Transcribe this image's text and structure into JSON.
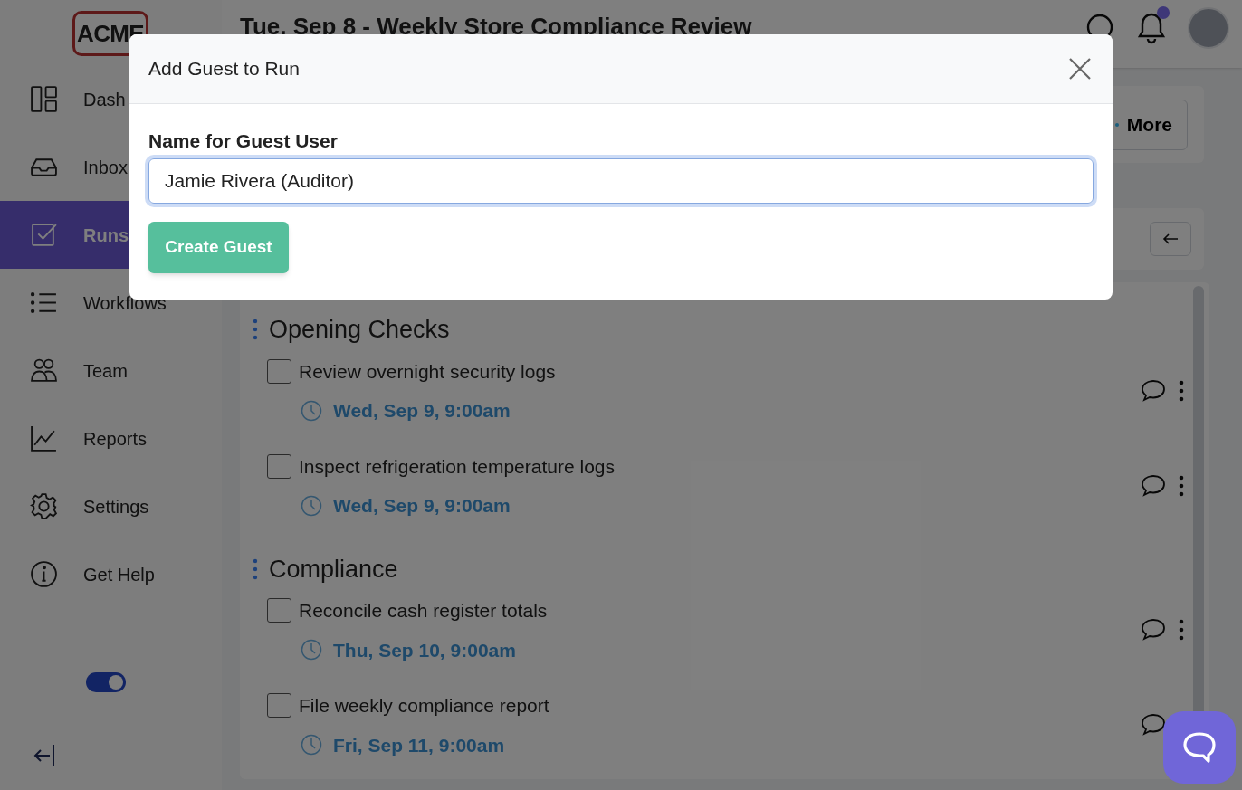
{
  "logo": {
    "text": "ACME"
  },
  "header": {
    "title": "Tue, Sep 8 - Weekly Store Compliance Review",
    "notifications_unread": true
  },
  "sidebar": {
    "items": [
      {
        "label": "Dash",
        "selected": false
      },
      {
        "label": "Inbox",
        "selected": false
      },
      {
        "label": "Runs",
        "selected": true
      },
      {
        "label": "Workflows",
        "selected": false
      },
      {
        "label": "Team",
        "selected": false
      },
      {
        "label": "Reports",
        "selected": false
      },
      {
        "label": "Settings",
        "selected": false
      },
      {
        "label": "Get Help",
        "selected": false
      }
    ],
    "toggle": {
      "on": true
    }
  },
  "toolbar": {
    "more_button": "More"
  },
  "sections": [
    {
      "title": "Opening Checks",
      "tasks": [
        {
          "label": "Review overnight security logs",
          "due": "Wed, Sep 9, 9:00am",
          "checked": false
        },
        {
          "label": "Inspect refrigeration temperature logs",
          "due": "Wed, Sep 9, 9:00am",
          "checked": false
        }
      ]
    },
    {
      "title": "Compliance",
      "tasks": [
        {
          "label": "Reconcile cash register totals",
          "due": "Thu, Sep 10, 9:00am",
          "checked": false
        },
        {
          "label": "File weekly compliance report",
          "due": "Fri, Sep 11, 9:00am",
          "checked": false
        }
      ]
    }
  ],
  "modal": {
    "title": "Add Guest to Run",
    "field_label": "Name for Guest User",
    "field_value": "Jamie Rivera (Auditor)",
    "submit_button": "Create Guest"
  }
}
